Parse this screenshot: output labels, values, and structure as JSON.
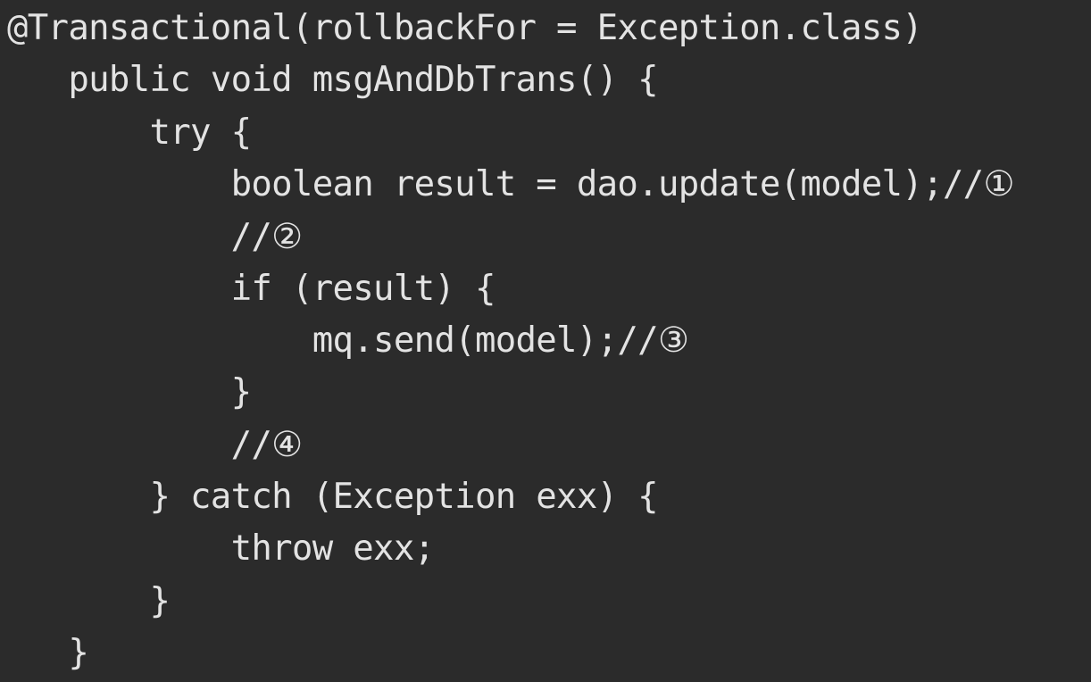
{
  "code_editor": {
    "background_color": "#2b2b2b",
    "text_color": "#e3e3e3",
    "lines": [
      "@Transactional(rollbackFor = Exception.class)",
      "   public void msgAndDbTrans() {",
      "       try {",
      "           boolean result = dao.update(model);//①",
      "           //②",
      "           if (result) {",
      "               mq.send(model);//③",
      "           }",
      "           //④",
      "       } catch (Exception exx) {",
      "           throw exx;",
      "       }",
      "   }"
    ]
  }
}
